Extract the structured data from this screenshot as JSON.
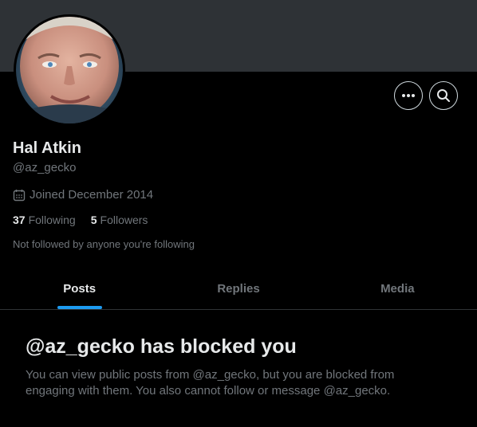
{
  "profile": {
    "display_name": "Hal Atkin",
    "handle": "@az_gecko",
    "joined": "Joined December 2014",
    "following_count": "37",
    "following_label": "Following",
    "followers_count": "5",
    "followers_label": "Followers",
    "not_followed_note": "Not followed by anyone you're following"
  },
  "actions": {
    "more_icon": "more-icon",
    "search_icon": "search-icon"
  },
  "tabs": [
    {
      "label": "Posts",
      "active": true
    },
    {
      "label": "Replies",
      "active": false
    },
    {
      "label": "Media",
      "active": false
    }
  ],
  "blocked": {
    "title": "@az_gecko has blocked you",
    "message": "You can view public posts from @az_gecko, but you are blocked from engaging with them. You also cannot follow or message @az_gecko."
  },
  "colors": {
    "background": "#000000",
    "banner": "#2e3236",
    "accent": "#1d9bf0",
    "primary_text": "#e7e9ea",
    "secondary_text": "#71767b"
  }
}
